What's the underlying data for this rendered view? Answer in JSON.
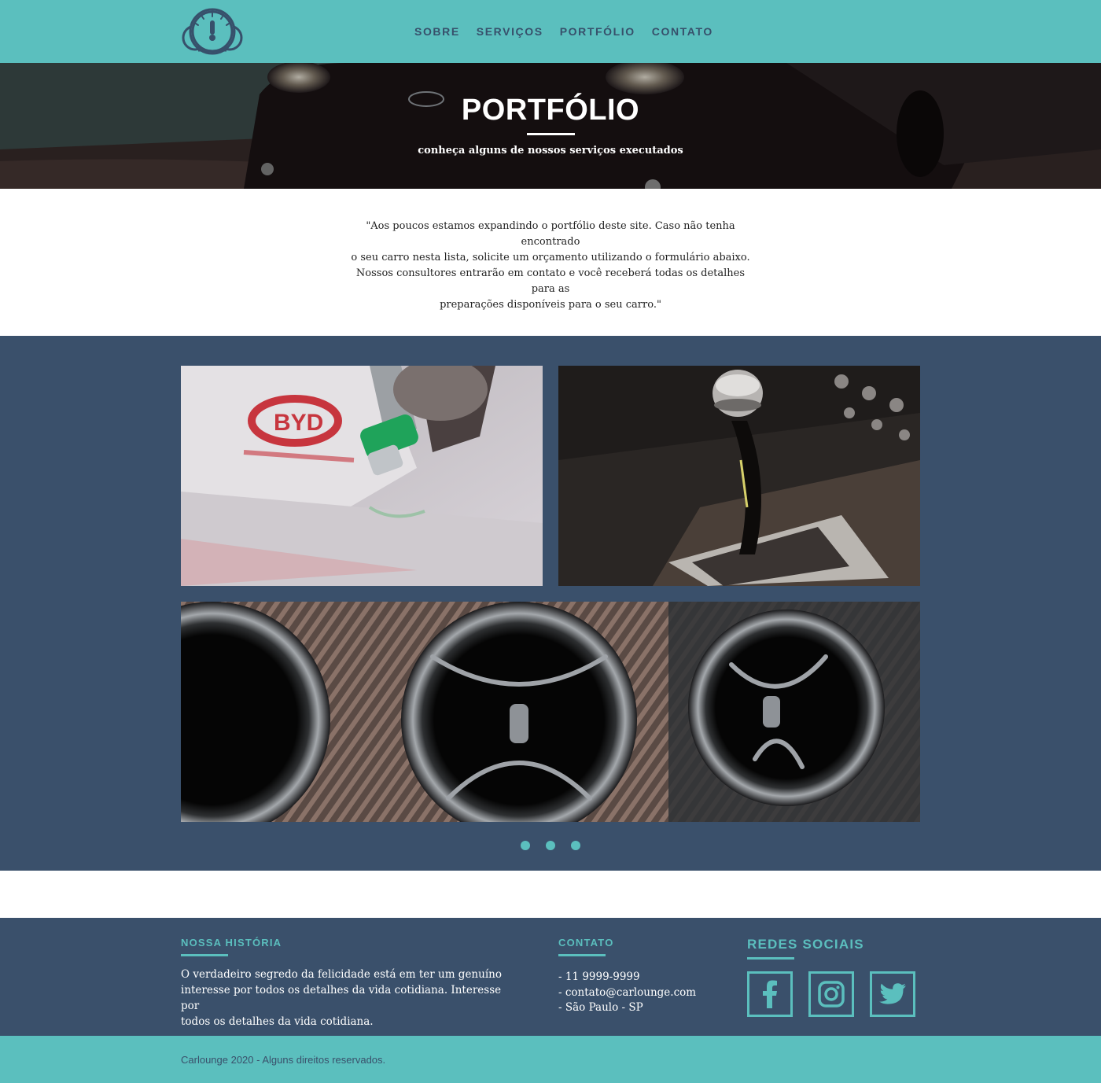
{
  "nav": {
    "items": [
      {
        "label": "SOBRE"
      },
      {
        "label": "SERVIÇOS"
      },
      {
        "label": "PORTFÓLIO"
      },
      {
        "label": "CONTATO"
      }
    ]
  },
  "hero": {
    "title": "PORTFÓLIO",
    "subtitle": "conheça alguns de nossos serviços executados"
  },
  "intro": {
    "line1": "\"Aos poucos estamos expandindo o portfólio deste site. Caso não tenha encontrado",
    "line2": "o seu carro nesta lista, solicite um orçamento utilizando o formulário abaixo.",
    "line3": "Nossos consultores entrarão em contato e você receberá todas os detalhes para as",
    "line4": "preparações disponíveis para o seu carro.\""
  },
  "gallery": {
    "slide_count": 3,
    "images": [
      {
        "icon": "spray-gun-photo"
      },
      {
        "icon": "gear-shift-photo"
      },
      {
        "icon": "air-vents-photo"
      }
    ]
  },
  "footer": {
    "history": {
      "heading": "NOSSA HISTÓRIA",
      "line1": "O verdadeiro segredo da felicidade está em ter um genuíno",
      "line2": "interesse por todos os detalhes da vida cotidiana. Interesse por",
      "line3": "todos os detalhes da vida cotidiana."
    },
    "contact": {
      "heading": "CONTATO",
      "phone": "- 11 9999-9999",
      "email": "- contato@carlounge.com",
      "city": "- São Paulo - SP"
    },
    "social": {
      "heading": "REDES SOCIAIS",
      "icons": [
        "facebook-icon",
        "instagram-icon",
        "twitter-icon"
      ]
    }
  },
  "copyright": "Carlounge 2020 - Alguns direitos reservados.",
  "colors": {
    "teal": "#5bbfbe",
    "navy": "#3a506b"
  }
}
